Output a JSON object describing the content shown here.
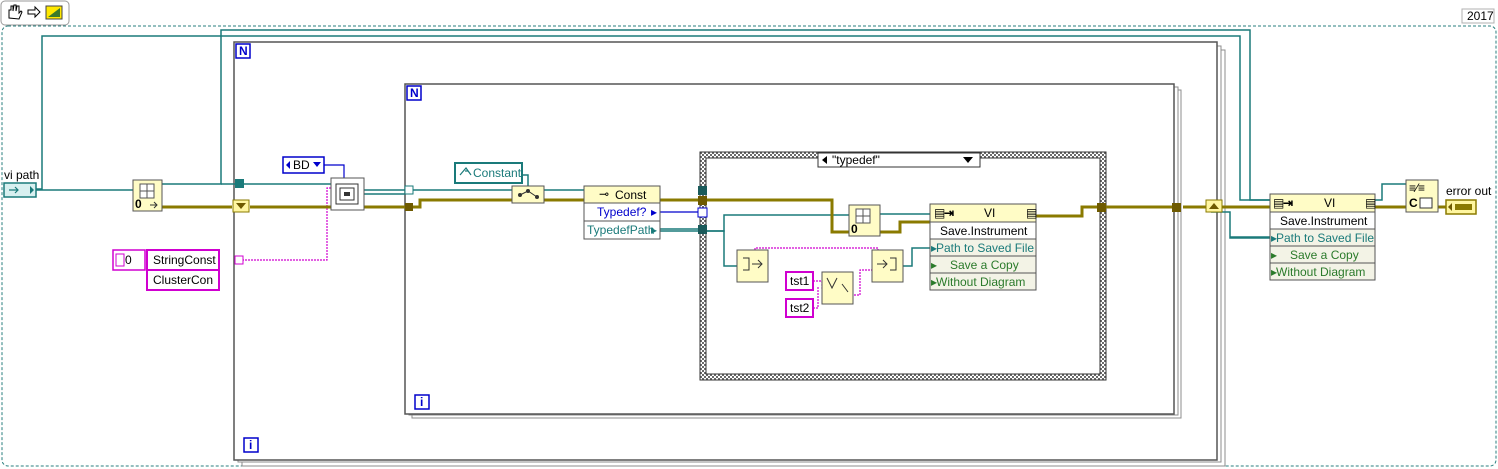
{
  "toolbar": {
    "icons": [
      "hand-icon",
      "arrow-icon",
      "run-icon"
    ],
    "version_badge": "2017"
  },
  "controls": {
    "vi_path": "vi path",
    "error_out": "error out"
  },
  "constants": {
    "index_zero_a": "0",
    "index_zero_b": "0",
    "array_index": "0",
    "string_const": "StringConst",
    "cluster_con": "ClusterCon",
    "bd_ring": "BD",
    "constant_class": "Constant",
    "tst1": "tst1",
    "tst2": "tst2"
  },
  "loops": {
    "outer_count": "N",
    "outer_iter": "i",
    "inner_count": "N",
    "inner_iter": "i"
  },
  "case_structure": {
    "selector": "\"typedef\""
  },
  "const_node": {
    "header": "Const",
    "row1": "Typedef?",
    "row2": "TypedefPath"
  },
  "inner_invoke": {
    "header": "VI",
    "method": "Save.Instrument",
    "rows": [
      "Path to Saved File",
      "Save a Copy",
      "Without Diagram"
    ]
  },
  "outer_invoke": {
    "header": "VI",
    "method": "Save.Instrument",
    "rows": [
      "Path to Saved File",
      "Save a Copy",
      "Without Diagram"
    ]
  },
  "colors": {
    "wire_reference": "#1a7a7a",
    "wire_error": "#9c8a00",
    "wire_cluster": "#d000d0",
    "wire_enum": "#0000cc",
    "node_fill": "#fffcc6",
    "structure_border": "#8c8c8c"
  }
}
